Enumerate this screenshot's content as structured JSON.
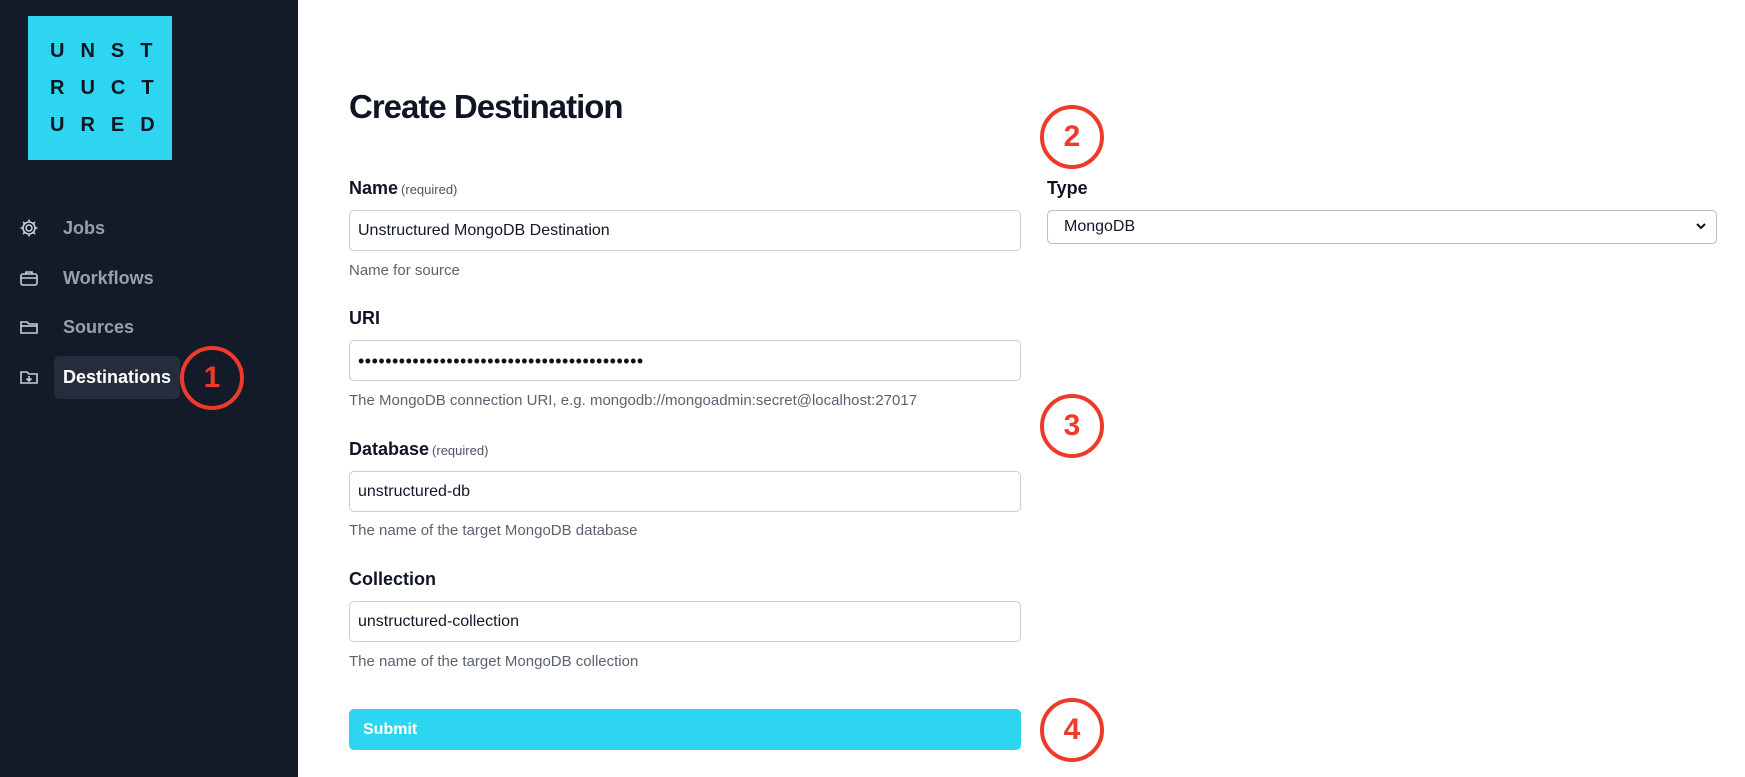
{
  "logo": {
    "rows": [
      "UNST",
      "RUCT",
      "URED"
    ]
  },
  "sidebar": {
    "items": [
      {
        "label": "Jobs",
        "icon": "gear-icon"
      },
      {
        "label": "Workflows",
        "icon": "briefcase-icon"
      },
      {
        "label": "Sources",
        "icon": "folder-icon"
      },
      {
        "label": "Destinations",
        "icon": "folder-download-icon",
        "active": true
      }
    ]
  },
  "page": {
    "title": "Create Destination"
  },
  "form": {
    "name": {
      "label": "Name",
      "required": "(required)",
      "value": "Unstructured MongoDB Destination",
      "help": "Name for source"
    },
    "type": {
      "label": "Type",
      "value": "MongoDB"
    },
    "uri": {
      "label": "URI",
      "value": "••••••••••••••••••••••••••••••••••••••••••",
      "help": "The MongoDB connection URI, e.g. mongodb://mongoadmin:secret@localhost:27017"
    },
    "database": {
      "label": "Database",
      "required": "(required)",
      "value": "unstructured-db",
      "help": "The name of the target MongoDB database"
    },
    "collection": {
      "label": "Collection",
      "value": "unstructured-collection",
      "help": "The name of the target MongoDB collection"
    },
    "submit_label": "Submit"
  },
  "markers": [
    "1",
    "2",
    "3",
    "4"
  ],
  "colors": {
    "accent": "#2ed5f0",
    "sidebar_bg": "#131a28",
    "marker": "#ee3a2a"
  }
}
